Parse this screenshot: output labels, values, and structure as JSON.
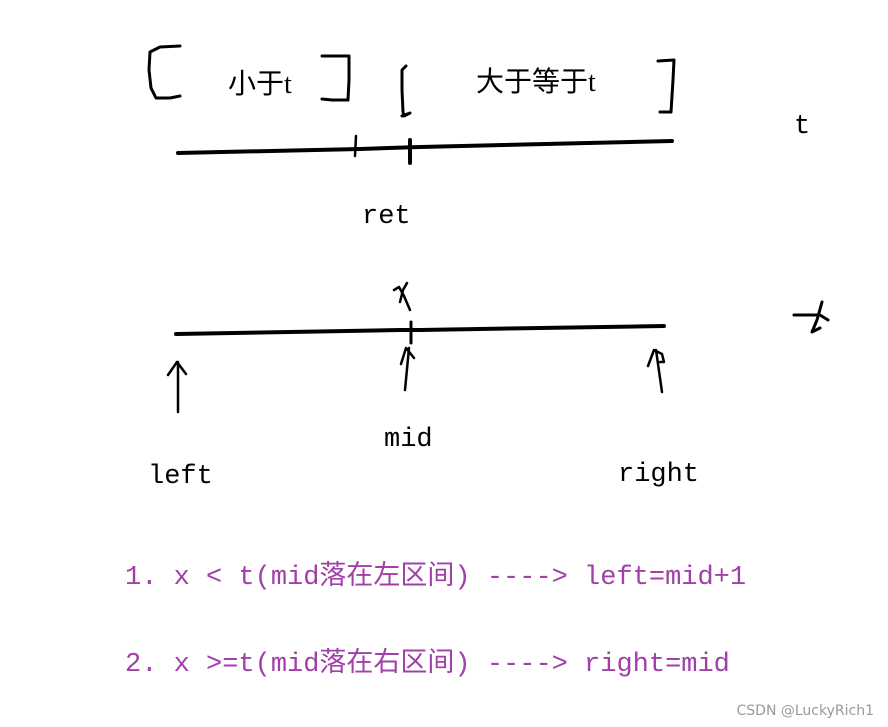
{
  "diagram": {
    "top": {
      "left_interval_label": "小于t",
      "right_interval_label": "大于等于t",
      "axis_label": "t",
      "boundary_label": "ret"
    },
    "bottom": {
      "x_label": "x",
      "axis_label": "t",
      "pointers": {
        "left": "left",
        "mid": "mid",
        "right": "right"
      }
    },
    "rules": [
      "1. x < t(mid落在左区间)  ----> left=mid+1",
      "2. x >=t(mid落在右区间)  ----> right=mid"
    ],
    "colors": {
      "ink": "#000000",
      "rule_text": "#a040a8",
      "watermark": "#9a9a9a"
    }
  },
  "watermark": "CSDN @LuckyRich1"
}
